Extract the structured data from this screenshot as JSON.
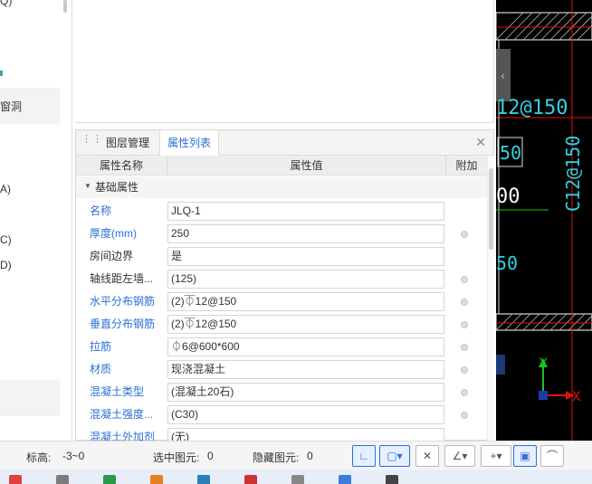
{
  "left_tree": {
    "items": [
      {
        "label": "Q)"
      },
      {
        "label": "窗洞"
      },
      {
        "label": "A)"
      },
      {
        "label": "C)"
      },
      {
        "label": "D)"
      }
    ]
  },
  "panel": {
    "tabs": [
      {
        "label": "图层管理",
        "active": false
      },
      {
        "label": "属性列表",
        "active": true
      }
    ],
    "close_icon": "close-icon",
    "headers": {
      "name": "属性名称",
      "value": "属性值",
      "extra": "附加"
    },
    "group_label": "基础属性",
    "rows": [
      {
        "name": "名称",
        "value": "JLQ-1",
        "blue": true,
        "checkbox": false
      },
      {
        "name": "厚度(mm)",
        "value": "250",
        "blue": true,
        "checkbox": true
      },
      {
        "name": "房间边界",
        "value": "是",
        "blue": false,
        "checkbox": false
      },
      {
        "name": "轴线距左墙...",
        "value": "(125)",
        "blue": false,
        "checkbox": true
      },
      {
        "name": "水平分布钢筋",
        "value": "(2)⏁12@150",
        "blue": true,
        "checkbox": true
      },
      {
        "name": "垂直分布钢筋",
        "value": "(2)⏁12@150",
        "blue": true,
        "checkbox": true
      },
      {
        "name": "拉筋",
        "value": "⏀6@600*600",
        "blue": true,
        "checkbox": true
      },
      {
        "name": "材质",
        "value": "现浇混凝土",
        "blue": true,
        "checkbox": true
      },
      {
        "name": "混凝土类型",
        "value": "(混凝土20石)",
        "blue": true,
        "checkbox": true
      },
      {
        "name": "混凝土强度...",
        "value": "(C30)",
        "blue": true,
        "checkbox": true
      },
      {
        "name": "混凝土外加剂",
        "value": "(无)",
        "blue": true,
        "checkbox": false
      }
    ]
  },
  "cad": {
    "label_1": "12@150",
    "label_2": "C12@150",
    "label_3": "50",
    "label_4": "00",
    "label_5": "50",
    "axis_y": "Y",
    "axis_x": "X",
    "colors": {
      "bg": "#000000",
      "red": "#e01010",
      "green": "#19c419",
      "cyan": "#2fd3e0",
      "white": "#ffffff"
    }
  },
  "status": {
    "elevation_label": "标高:",
    "elevation_value": "-3~0",
    "selected_label": "选中图元:",
    "selected_value": "0",
    "hidden_label": "隐藏图元:",
    "hidden_value": "0"
  },
  "taskbar": {
    "colors": [
      "#e04040",
      "#7c7c7c",
      "#2a9a4a",
      "#e67e22",
      "#2980b9",
      "#cc3333",
      "#888888",
      "#3b7dd8",
      "#444444"
    ]
  }
}
